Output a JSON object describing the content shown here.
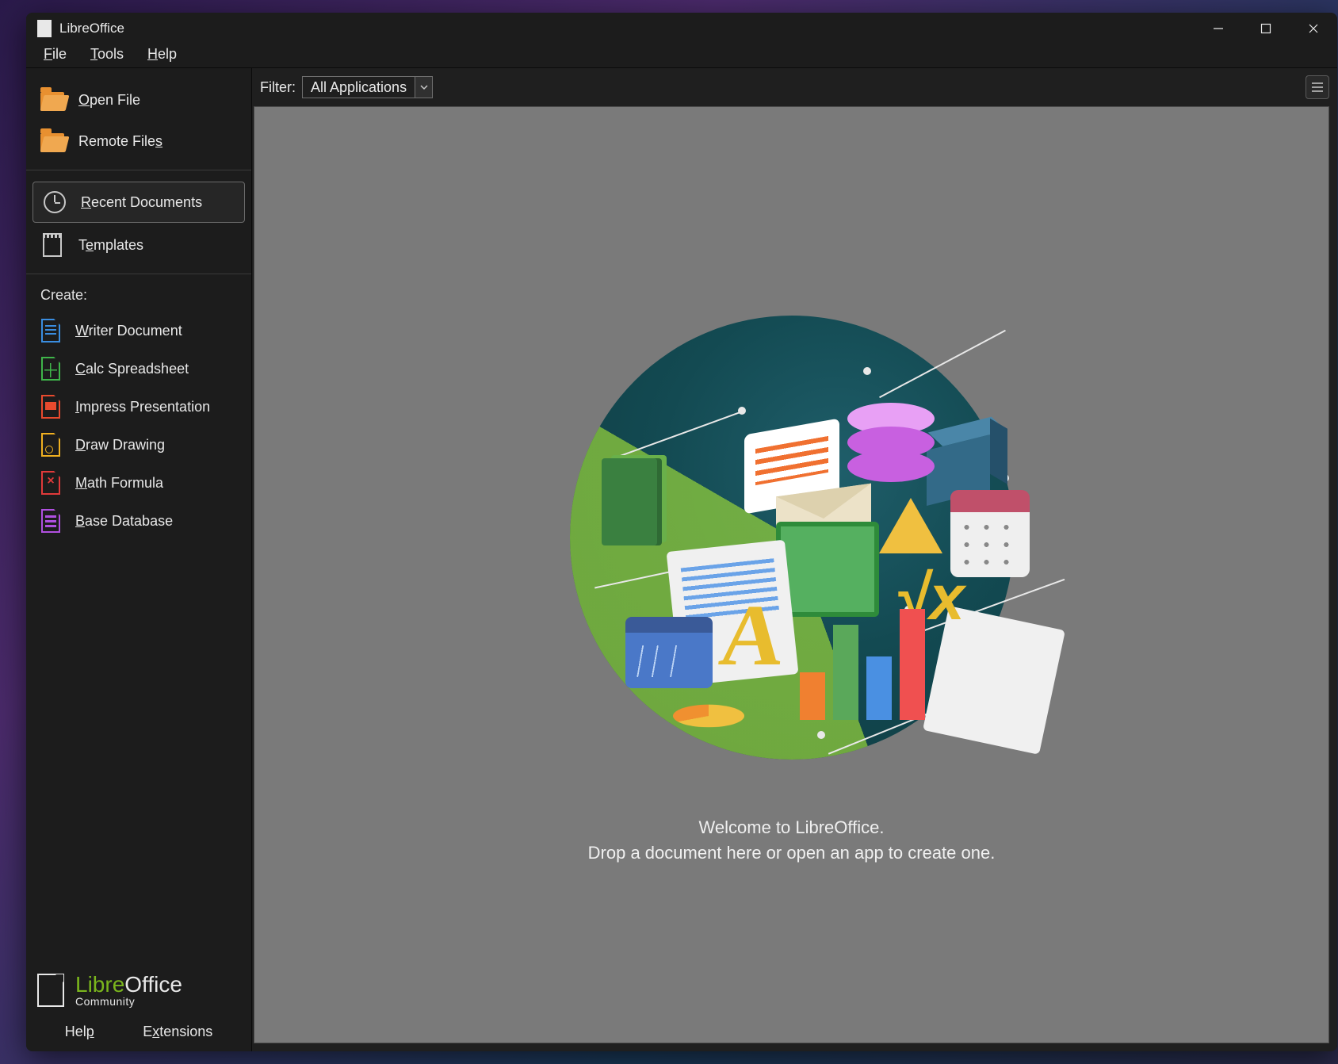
{
  "window": {
    "title": "LibreOffice"
  },
  "menubar": {
    "file": "File",
    "tools": "Tools",
    "help": "Help"
  },
  "sidebar": {
    "open_file": "Open File",
    "remote_files": "Remote Files",
    "recent_documents": "Recent Documents",
    "templates": "Templates",
    "create_header": "Create:",
    "writer": "Writer Document",
    "calc": "Calc Spreadsheet",
    "impress": "Impress Presentation",
    "draw": "Draw Drawing",
    "math": "Math Formula",
    "base": "Base Database",
    "brand_libre": "Libre",
    "brand_office": "Office",
    "brand_sub": "Community",
    "help_link": "Help",
    "extensions_link": "Extensions"
  },
  "main": {
    "filter_label": "Filter:",
    "filter_value": "All Applications",
    "welcome_line1": "Welcome to LibreOffice.",
    "welcome_line2": "Drop a document here or open an app to create one."
  }
}
